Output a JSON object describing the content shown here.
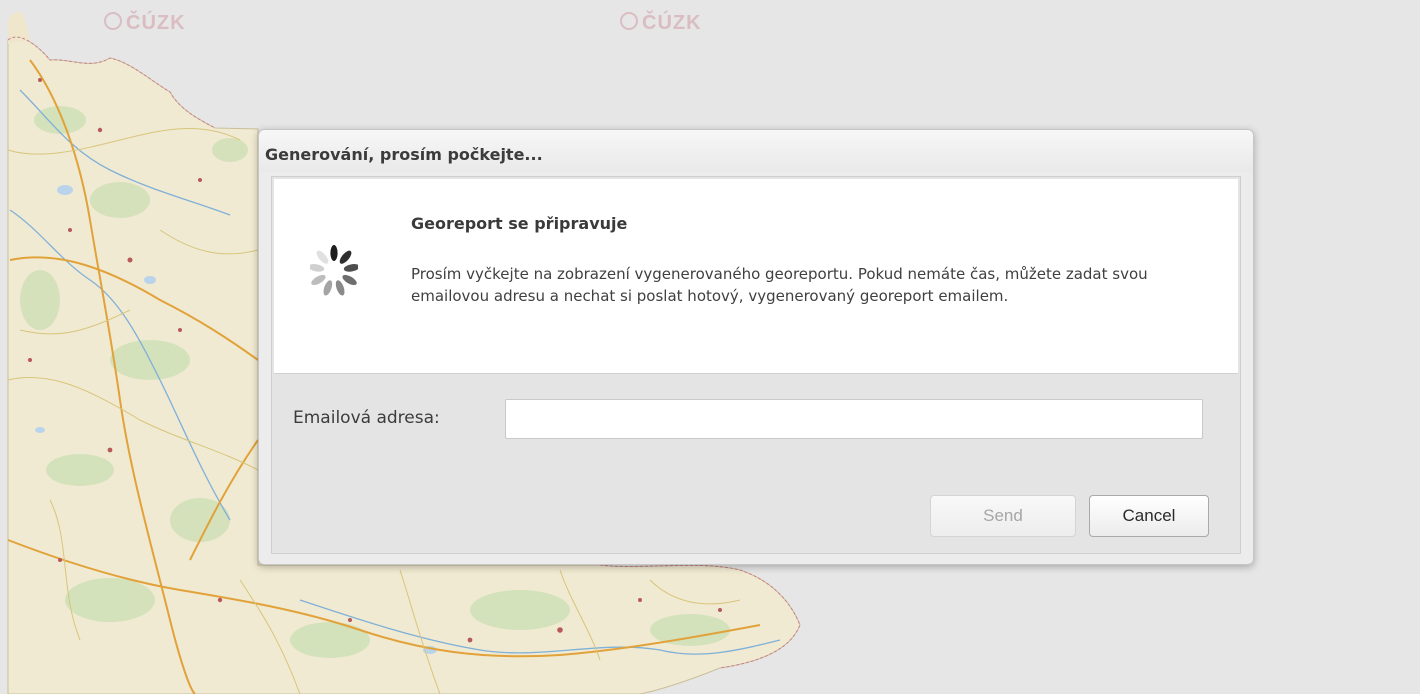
{
  "map": {
    "watermarks": [
      "ČÚZK",
      "ČÚZK"
    ]
  },
  "dialog": {
    "title": "Generování, prosím počkejte...",
    "spinner_icon": "loading-spinner-icon",
    "message": {
      "heading": "Georeport se připravuje",
      "text": "Prosím vyčkejte na zobrazení vygenerovaného georeportu. Pokud nemáte čas, můžete zadat svou emailovou adresu a nechat si poslat hotový, vygenerovaný georeport emailem."
    },
    "email": {
      "label": "Emailová adresa:",
      "value": "",
      "placeholder": ""
    },
    "buttons": {
      "send_label": "Send",
      "send_disabled": true,
      "cancel_label": "Cancel"
    }
  }
}
